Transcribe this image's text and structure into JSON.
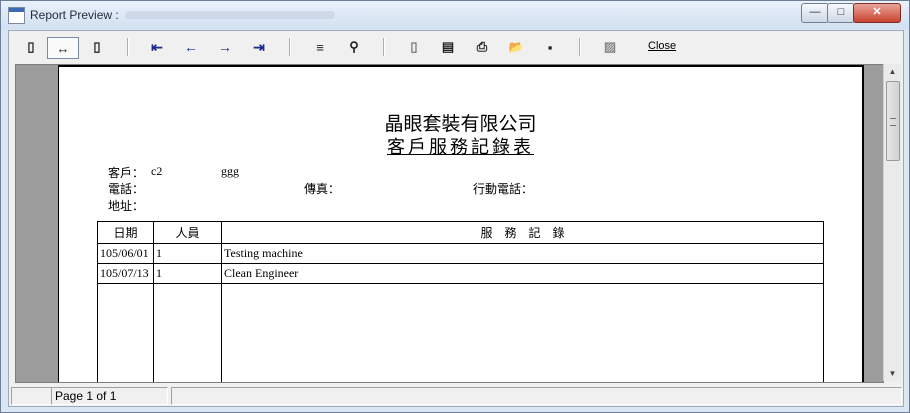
{
  "window": {
    "title": "Report Preview :",
    "min_glyph": "—",
    "max_glyph": "□",
    "close_glyph": "✕"
  },
  "toolbar": {
    "page_width_glyph": "▯",
    "fit_page_glyph": "↔",
    "zoom_glyph": "▯",
    "first_glyph": "⇤",
    "prev_glyph": "←",
    "next_glyph": "→",
    "last_glyph": "⇥",
    "goto_glyph": "≡",
    "find_glyph": "⚲",
    "copy_glyph": "▯",
    "export_glyph": "▤",
    "print_glyph": "⎙",
    "open_glyph": "📂",
    "save_glyph": "▪",
    "options_glyph": "▨",
    "close_label": "Close"
  },
  "report": {
    "company": "晶眼套裝有限公司",
    "title": "客戶服務記錄表",
    "customer_label": "客戶：",
    "customer_code": "c2",
    "customer_name": "ggg",
    "phone_label": "電話：",
    "fax_label": "傳真：",
    "mobile_label": "行動電話：",
    "address_label": "地址：",
    "columns": [
      "日期",
      "人員",
      "服　務　記　錄"
    ],
    "rows": [
      {
        "date": "105/06/01",
        "staff": "1",
        "record": "Testing machine"
      },
      {
        "date": "105/07/13",
        "staff": "1",
        "record": "Clean Engineer"
      }
    ]
  },
  "statusbar": {
    "page_text": "Page 1 of 1"
  }
}
